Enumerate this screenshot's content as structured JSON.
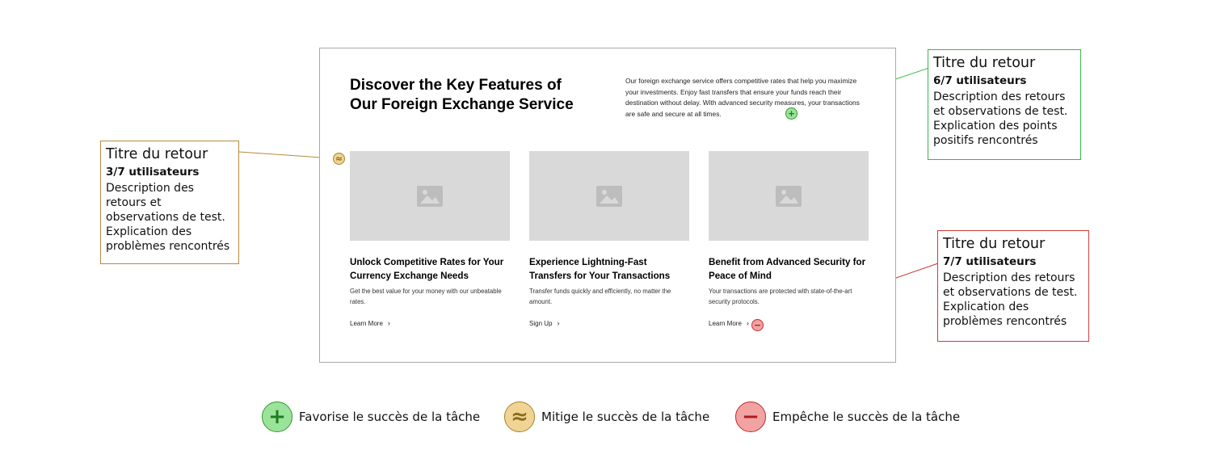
{
  "mockup": {
    "title": "Discover the Key Features of Our Foreign Exchange Service",
    "intro": "Our foreign exchange service offers competitive rates that help you maximize your investments. Enjoy fast transfers that ensure your funds reach their destination without delay. With advanced security measures, your transactions are safe and secure at all times.",
    "cards": [
      {
        "title": "Unlock Competitive Rates for Your Currency Exchange Needs",
        "text": "Get the best value for your money with our unbeatable rates.",
        "link": "Learn More",
        "link_icon": "chevron-right-icon"
      },
      {
        "title": "Experience Lightning-Fast Transfers for Your Transactions",
        "text": "Transfer funds quickly and efficiently, no matter the amount.",
        "link": "Sign Up",
        "link_icon": "chevron-right-icon"
      },
      {
        "title": "Benefit from Advanced Security for Peace of Mind",
        "text": "Your transactions are protected with state-of-the-art security protocols.",
        "link": "Learn More",
        "link_icon": "chevron-right-icon"
      }
    ],
    "image_placeholder_icon": "image-placeholder-icon"
  },
  "feedback": {
    "left": {
      "title": "Titre du retour",
      "users": "3/7 utilisateurs",
      "description": "Description des retours et observations de test. Explication des problèmes rencontrés",
      "type": "mitigates",
      "color": "#b78a3f"
    },
    "right_top": {
      "title": "Titre du retour",
      "users": "6/7 utilisateurs",
      "description": "Description des retours et observations de test. Explication des points positifs rencontrés",
      "type": "favors",
      "color": "#3bb54a"
    },
    "right_bottom": {
      "title": "Titre du retour",
      "users": "7/7 utilisateurs",
      "description": "Description des retours et observations de test. Explication des problèmes rencontrés",
      "type": "prevents",
      "color": "#d13a3a"
    }
  },
  "markers": {
    "positive_symbol": "+",
    "mitigate_symbol": "≈",
    "negative_symbol": "−"
  },
  "legend": [
    {
      "symbol": "+",
      "label": "Favorise le succès de la tâche",
      "icon": "plus-icon",
      "color": "#2f9a2f"
    },
    {
      "symbol": "≈",
      "label": "Mitige le succès de la tâche",
      "icon": "approx-icon",
      "color": "#a8822d"
    },
    {
      "symbol": "−",
      "label": "Empêche le succès de la tâche",
      "icon": "minus-icon",
      "color": "#c62a2a"
    }
  ]
}
